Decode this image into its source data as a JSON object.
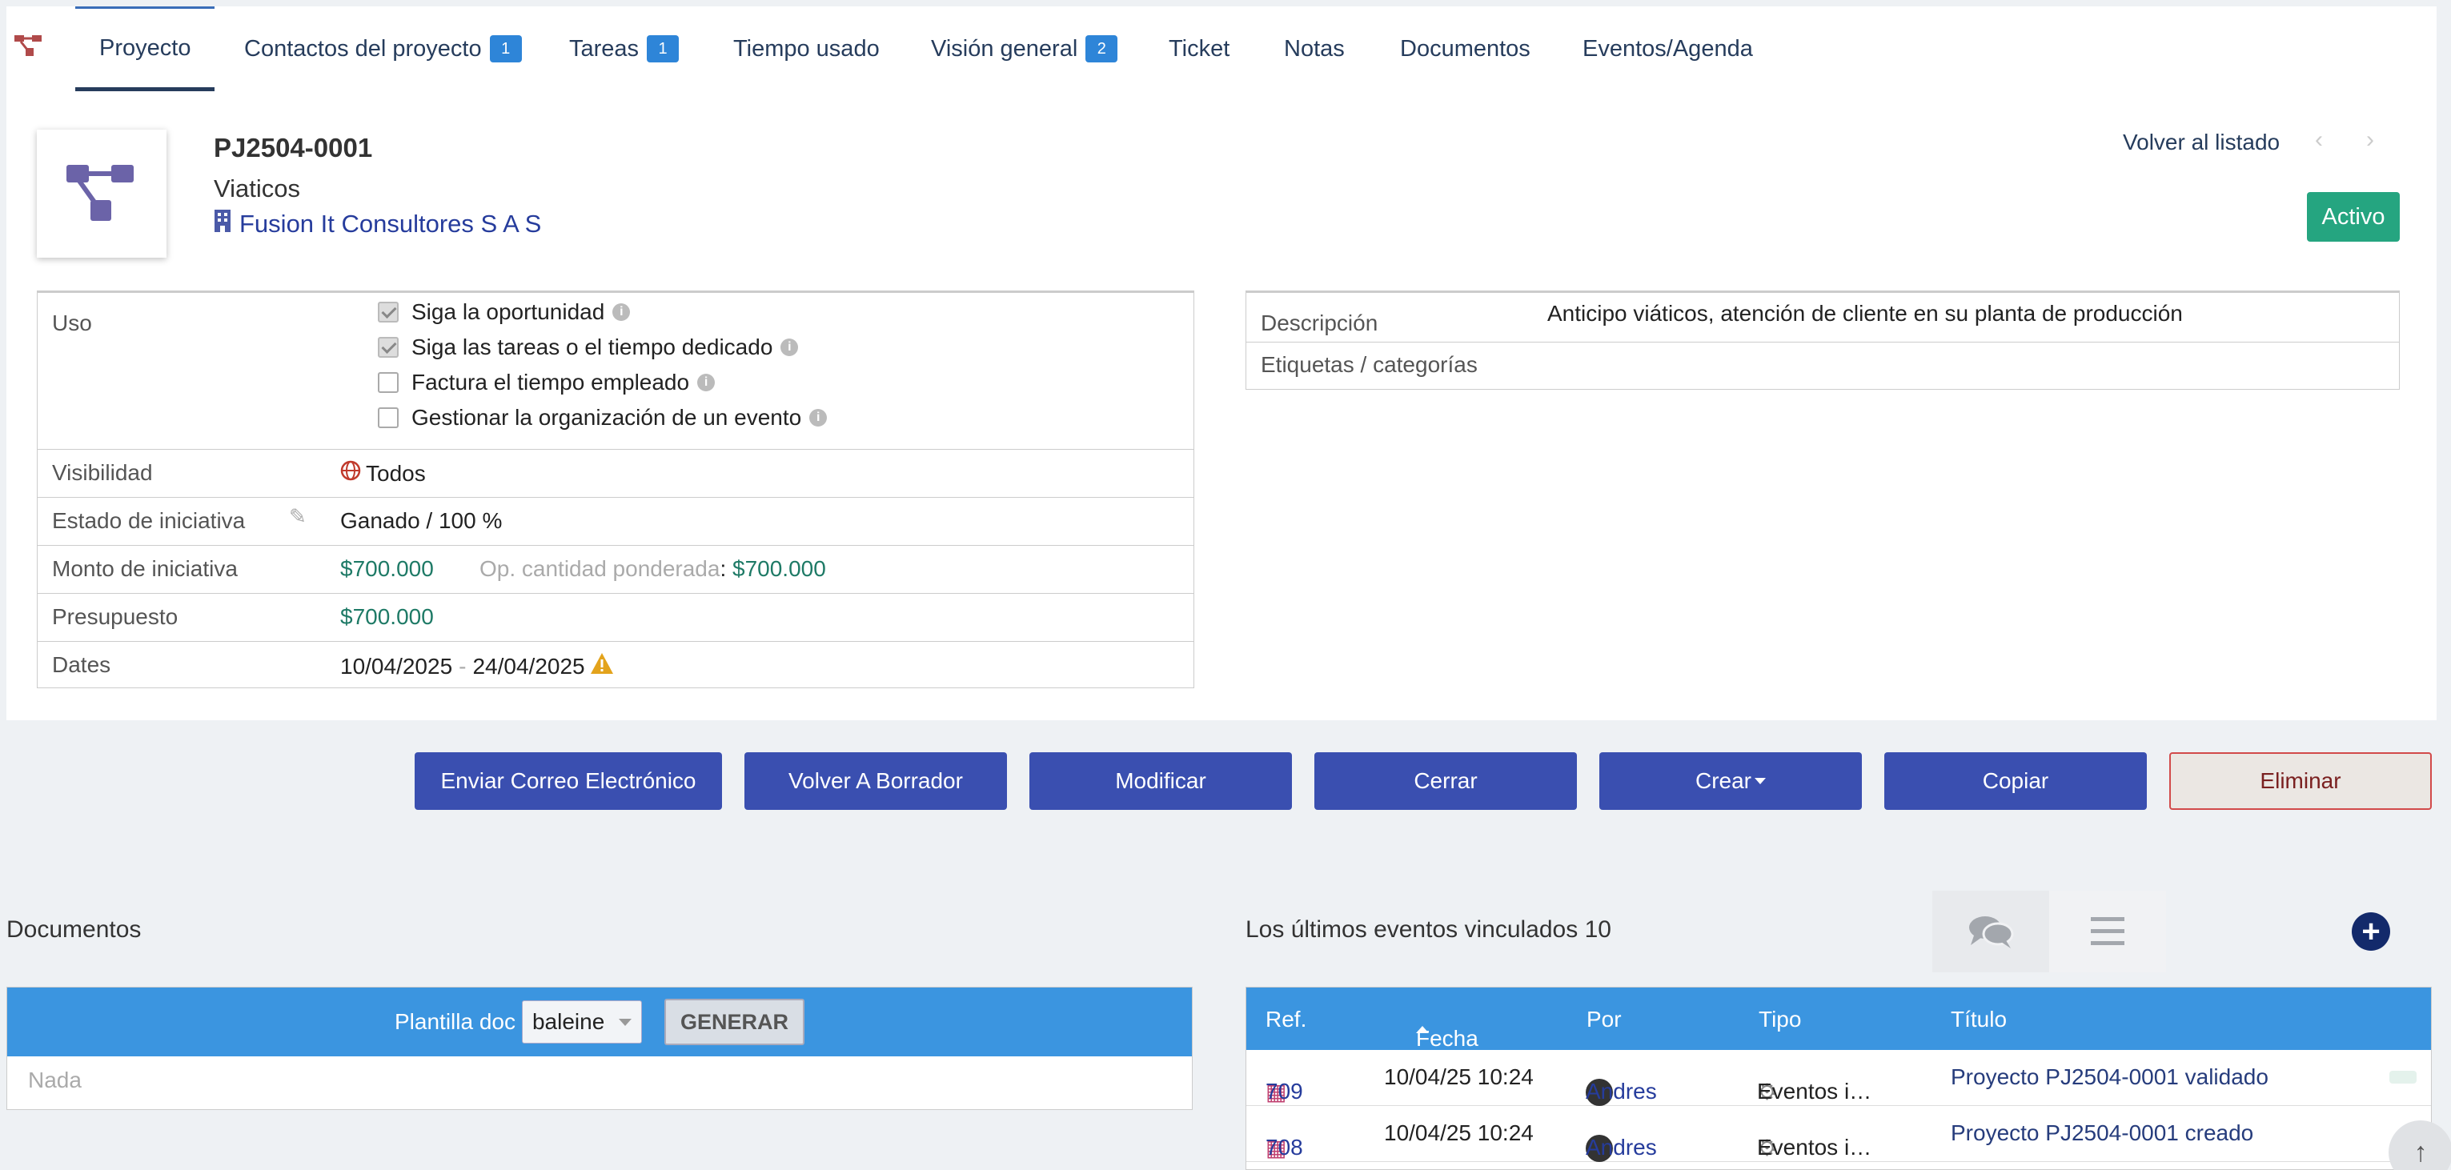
{
  "tabs": [
    {
      "label": "Proyecto",
      "badge": ""
    },
    {
      "label": "Contactos del proyecto",
      "badge": "1"
    },
    {
      "label": "Tareas",
      "badge": "1"
    },
    {
      "label": "Tiempo usado",
      "badge": ""
    },
    {
      "label": "Visión general",
      "badge": "2"
    },
    {
      "label": "Ticket",
      "badge": ""
    },
    {
      "label": "Notas",
      "badge": ""
    },
    {
      "label": "Documentos",
      "badge": ""
    },
    {
      "label": "Eventos/Agenda",
      "badge": ""
    }
  ],
  "header": {
    "ref": "PJ2504-0001",
    "label": "Viaticos",
    "company": "Fusion It Consultores S A S",
    "back_link": "Volver al listado",
    "status": "Activo",
    "status_color": "#25a580"
  },
  "left_fields": {
    "uso_label": "Uso",
    "uso_options": [
      {
        "label": "Siga la oportunidad",
        "checked": true
      },
      {
        "label": "Siga las tareas o el tiempo dedicado",
        "checked": true
      },
      {
        "label": "Factura el tiempo empleado",
        "checked": false
      },
      {
        "label": "Gestionar la organización de un evento",
        "checked": false
      }
    ],
    "visibilidad_label": "Visibilidad",
    "visibilidad_value": "Todos",
    "estado_label": "Estado de iniciativa",
    "estado_value": "Ganado / 100 %",
    "monto_label": "Monto de iniciativa",
    "monto_value": "$700.000",
    "ponderada_label": "Op. cantidad ponderada",
    "ponderada_value": "$700.000",
    "presupuesto_label": "Presupuesto",
    "presupuesto_value": "$700.000",
    "dates_label": "Dates",
    "date_start": "10/04/2025",
    "date_sep": "-",
    "date_end": "24/04/2025"
  },
  "right_fields": {
    "descripcion_label": "Descripción",
    "descripcion_value": "Anticipo viáticos, atención de cliente en su planta de producción",
    "etiquetas_label": "Etiquetas / categorías"
  },
  "actions": {
    "email": "Enviar Correo Electrónico",
    "draft": "Volver A Borrador",
    "modify": "Modificar",
    "close": "Cerrar",
    "create": "Crear",
    "copy": "Copiar",
    "delete": "Eliminar"
  },
  "documents": {
    "title": "Documentos",
    "template_label": "Plantilla doc",
    "template_value": "baleine",
    "generate": "GENERAR",
    "empty": "Nada"
  },
  "events": {
    "title": "Los últimos eventos vinculados",
    "count": "10",
    "columns": [
      "Ref.",
      "Fecha",
      "Por",
      "Tipo",
      "Título"
    ],
    "rows": [
      {
        "ref": "709",
        "date": "10/04/25 10:24",
        "user": "Andres",
        "type": "Eventos i…",
        "title": "Proyecto PJ2504-0001 validado"
      },
      {
        "ref": "708",
        "date": "10/04/25 10:24",
        "user": "Andres",
        "type": "Eventos i…",
        "title": "Proyecto PJ2504-0001 creado"
      }
    ]
  }
}
